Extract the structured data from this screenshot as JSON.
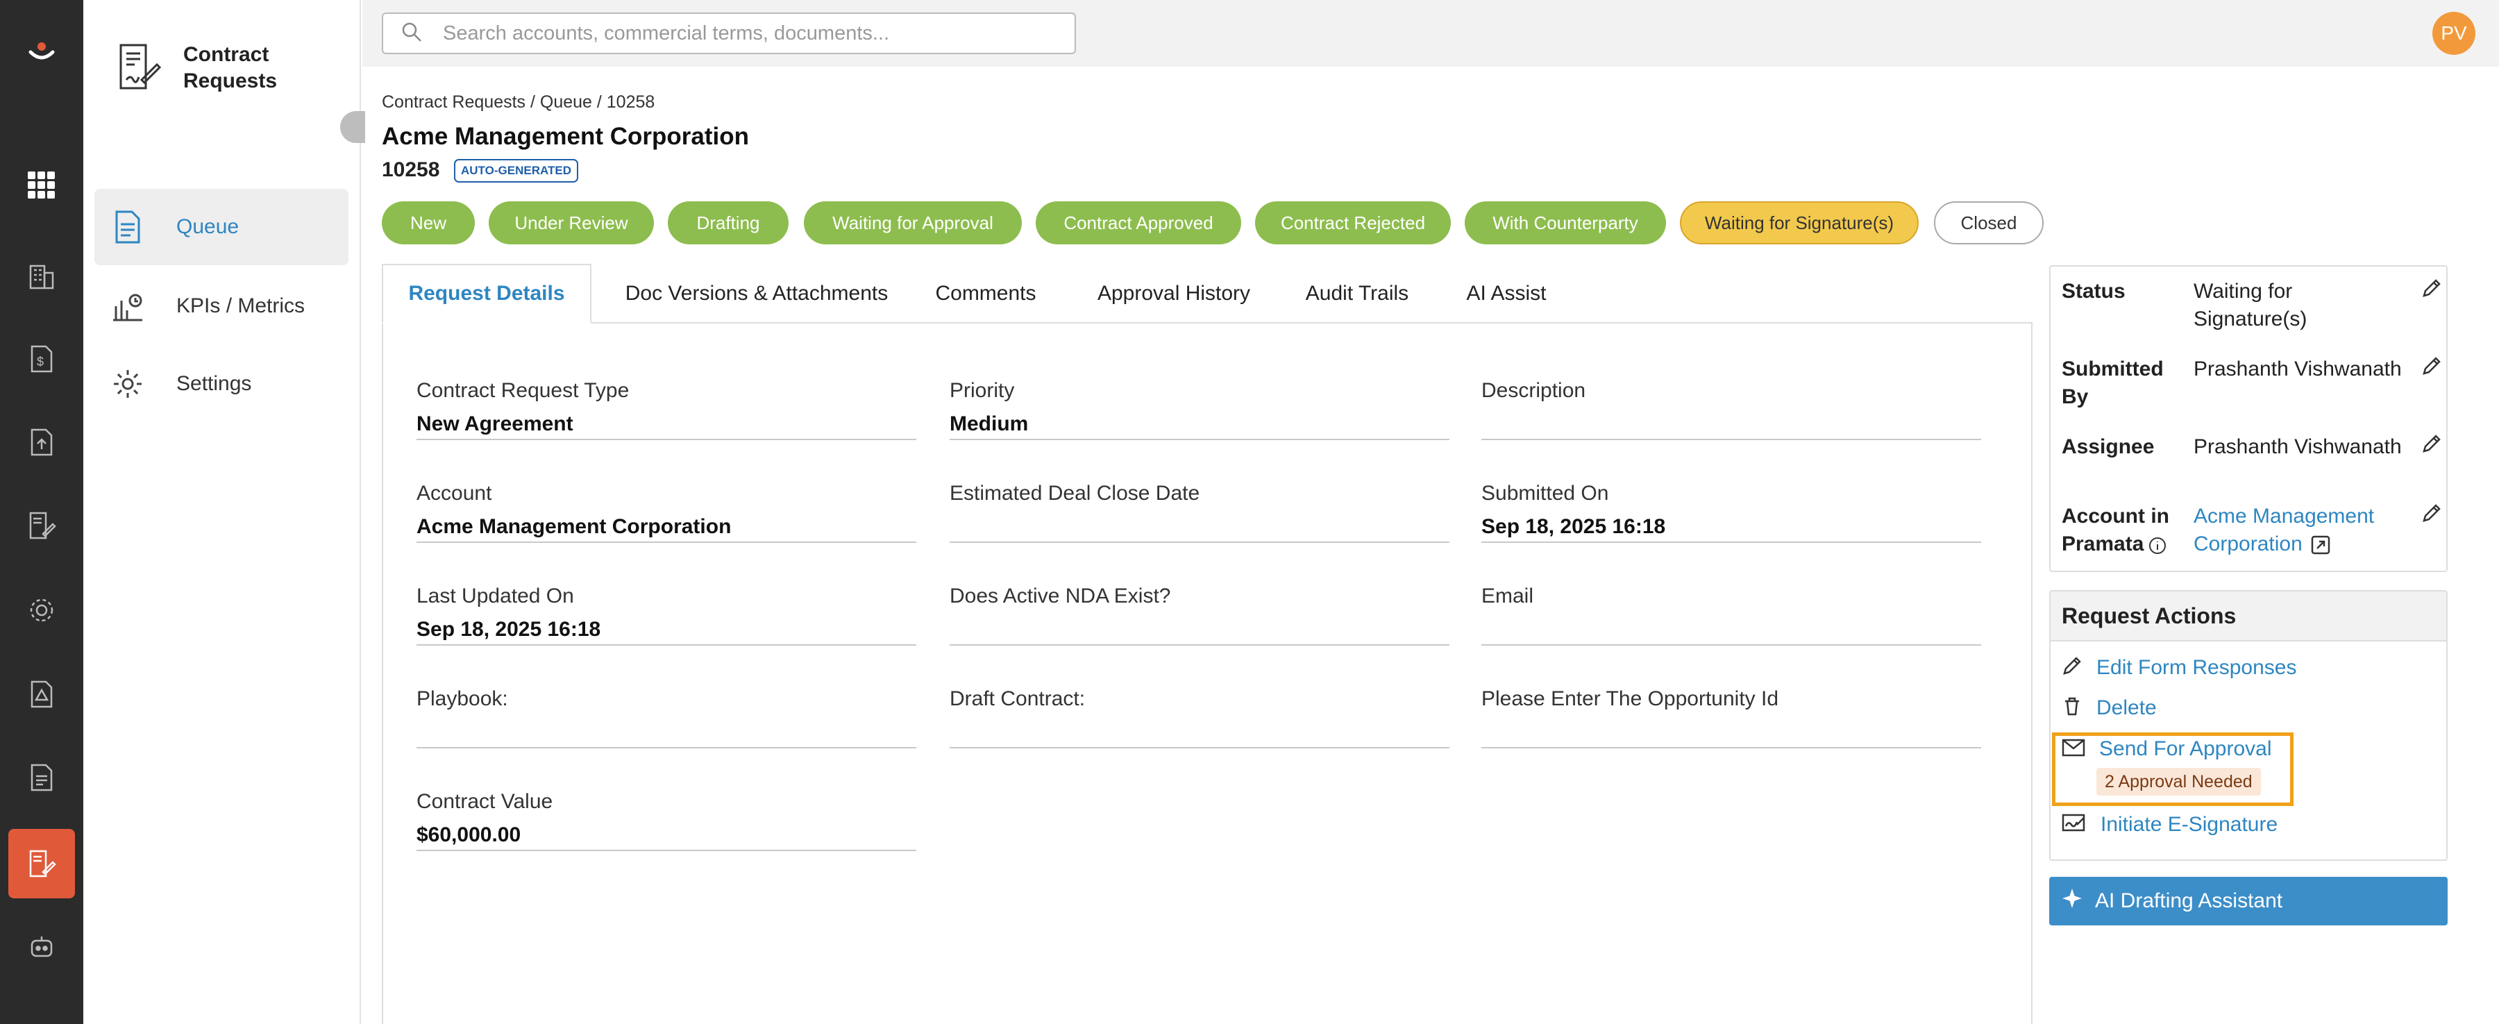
{
  "app": {
    "logo": "app-logo-icon",
    "accent": "#e05a3a"
  },
  "rail": {
    "icons": [
      "grid-icon",
      "building-icon",
      "dollar-doc-icon",
      "upload-doc-icon",
      "sign-doc-icon",
      "gear-network-icon",
      "alert-doc-icon",
      "bill-doc-icon",
      "contract-edit-icon",
      "robot-icon"
    ]
  },
  "sidebar": {
    "title": "Contract Requests",
    "items": [
      {
        "label": "Queue",
        "icon": "document-icon",
        "active": true
      },
      {
        "label": "KPIs / Metrics",
        "icon": "chart-icon"
      },
      {
        "label": "Settings",
        "icon": "gear-icon"
      }
    ]
  },
  "search": {
    "placeholder": "Search accounts, commercial terms, documents..."
  },
  "user": {
    "initials": "PV"
  },
  "breadcrumb": "Contract Requests / Queue / 10258",
  "page": {
    "title": "Acme Management Corporation",
    "id": "10258",
    "badge": "AUTO-GENERATED"
  },
  "stages": [
    {
      "label": "New",
      "state": "done"
    },
    {
      "label": "Under Review",
      "state": "done"
    },
    {
      "label": "Drafting",
      "state": "done"
    },
    {
      "label": "Waiting for Approval",
      "state": "done"
    },
    {
      "label": "Contract Approved",
      "state": "done"
    },
    {
      "label": "Contract Rejected",
      "state": "done"
    },
    {
      "label": "With Counterparty",
      "state": "done"
    },
    {
      "label": "Waiting for Signature(s)",
      "state": "current"
    },
    {
      "label": "Closed",
      "state": "future"
    }
  ],
  "tabs": [
    "Request Details",
    "Doc Versions & Attachments",
    "Comments",
    "Approval History",
    "Audit Trails",
    "AI Assist"
  ],
  "fields": [
    {
      "label": "Contract Request Type",
      "value": "New Agreement"
    },
    {
      "label": "Priority",
      "value": "Medium"
    },
    {
      "label": "Description",
      "value": ""
    },
    {
      "label": "Account",
      "value": "Acme Management Corporation"
    },
    {
      "label": "Estimated Deal Close Date",
      "value": ""
    },
    {
      "label": "Submitted On",
      "value": "Sep 18, 2025 16:18"
    },
    {
      "label": "Last Updated On",
      "value": "Sep 18, 2025 16:18"
    },
    {
      "label": "Does Active NDA Exist?",
      "value": ""
    },
    {
      "label": "Email",
      "value": ""
    },
    {
      "label": "Playbook:",
      "value": ""
    },
    {
      "label": "Draft Contract:",
      "value": ""
    },
    {
      "label": "Please Enter The Opportunity Id",
      "value": ""
    },
    {
      "label": "Contract Value",
      "value": "$60,000.00"
    }
  ],
  "properties": {
    "status": {
      "label": "Status",
      "value": "Waiting for Signature(s)"
    },
    "submitted_by": {
      "label": "Submitted By",
      "value": "Prashanth Vishwanath"
    },
    "assignee": {
      "label": "Assignee",
      "value": "Prashanth Vishwanath"
    },
    "account": {
      "label": "Account in Pramata",
      "value": "Acme Management Corporation"
    }
  },
  "actions": {
    "title": "Request Actions",
    "edit": "Edit Form Responses",
    "delete": "Delete",
    "send": "Send For Approval",
    "approvals_badge": "2 Approval Needed",
    "esign": "Initiate E-Signature"
  },
  "ai_button": "AI Drafting Assistant"
}
